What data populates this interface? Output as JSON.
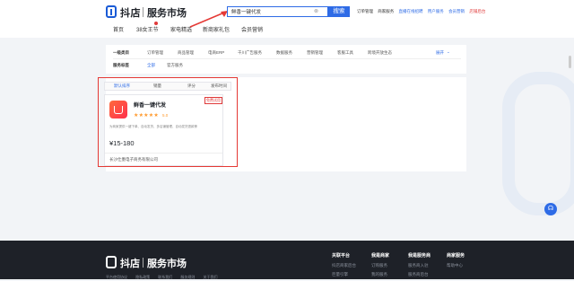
{
  "header": {
    "logo": "抖店",
    "logo_sub": "服务市场",
    "search_value": "鲜香一键代发",
    "search_button": "搜索",
    "links": [
      "订单管理",
      "商家服务",
      "直播在线招聘",
      "用户服务",
      "会员营销",
      "店铺后台"
    ]
  },
  "nav": [
    "首页",
    "38女王节",
    "家电精选",
    "新商家礼包",
    "会员营销"
  ],
  "filter": {
    "row1_label": "一级类目",
    "row1": [
      "订单管理",
      "商品管理",
      "电商ERP",
      "千川广告服务",
      "数据服务",
      "营销管理",
      "客服工具",
      "跨境开放生态"
    ],
    "row1_more": "展开",
    "row2_label": "服务标签",
    "row2": [
      "全部",
      "官方服务"
    ]
  },
  "tabs": [
    "默认排序",
    "销量",
    "评分",
    "发布时间"
  ],
  "card": {
    "badge": "免费试用",
    "name": "鲜香一键代发",
    "stars": "★★★★★",
    "rating": "5.0",
    "description": "为商家提供一键下单、自动发货、多店铺管理、自动发货退款等",
    "price": "¥15-180",
    "company": "长沙仕墨电子商务有限公司"
  },
  "footer": {
    "logo": "抖店",
    "logo_sub": "服务市场",
    "cols": [
      {
        "title": "关联平台",
        "items": [
          "抖店商家后台",
          "巨量引擎"
        ]
      },
      {
        "title": "我是商家",
        "items": [
          "订购服务",
          "我的服务"
        ]
      },
      {
        "title": "我是服务商",
        "items": [
          "服务商入驻",
          "服务商后台"
        ]
      },
      {
        "title": "商家服务",
        "items": [
          "帮助中心"
        ]
      }
    ],
    "bottom": [
      "平台使用协议",
      "隐私政策",
      "联系我们",
      "服务规则",
      "关于我们"
    ]
  },
  "colors": {
    "accent": "#2e6be6",
    "highlight": "#e53935",
    "footer_bg": "#1e2128"
  }
}
